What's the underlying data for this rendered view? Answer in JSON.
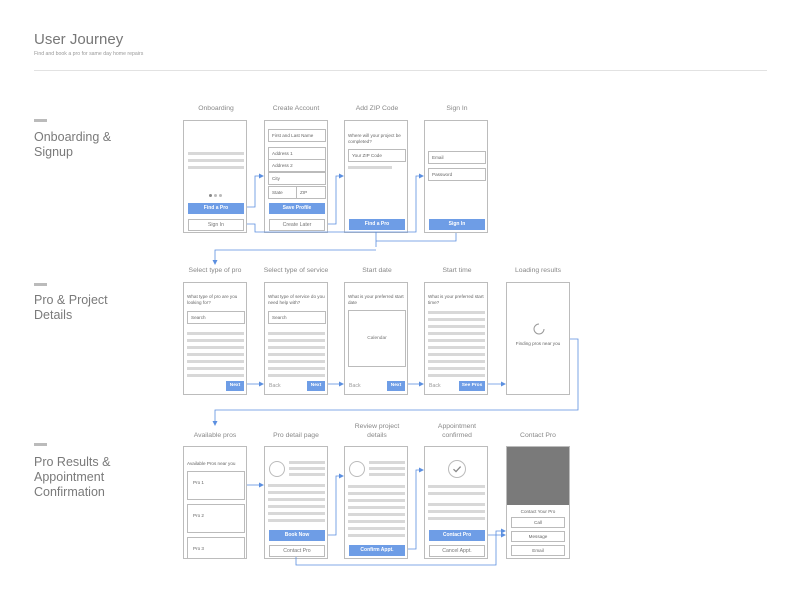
{
  "header": {
    "title": "User Journey",
    "subtitle": "Find and book a pro for same day home repairs"
  },
  "sections": {
    "onboarding": {
      "title": "Onboarding &\nSignup"
    },
    "details": {
      "title": "Pro & Project\nDetails"
    },
    "results": {
      "title": "Pro Results &\nAppointment\nConfirmation"
    }
  },
  "screens": {
    "onboarding": {
      "title": "Onboarding",
      "primary": "Find a Pro",
      "secondary": "Sign In"
    },
    "create_account": {
      "title": "Create Account",
      "fields": [
        "First and Last Name",
        "Address 1",
        "Address 2",
        "City"
      ],
      "state": "State",
      "zip": "ZIP",
      "primary": "Save Profile",
      "secondary": "Create Later"
    },
    "add_zip": {
      "title": "Add ZIP Code",
      "prompt": "Where will your project be completed?",
      "field": "Your ZIP Code",
      "primary": "Find a Pro"
    },
    "sign_in": {
      "title": "Sign In",
      "email": "Email",
      "password": "Password",
      "primary": "Sign In"
    },
    "select_pro": {
      "title": "Select type of pro",
      "prompt": "What type of pro are you looking for?",
      "search": "Search",
      "next": "Next"
    },
    "select_service": {
      "title": "Select type of service",
      "prompt": "What type of service do you need help with?",
      "search": "Search",
      "back": "Back",
      "next": "Next"
    },
    "start_date": {
      "title": "Start date",
      "prompt": "What is your preferred start date",
      "calendar": "Calendar",
      "back": "Back",
      "next": "Next"
    },
    "start_time": {
      "title": "Start time",
      "prompt": "What is your preferred start time?",
      "back": "Back",
      "next": "See Pros"
    },
    "loading": {
      "title": "Loading results",
      "message": "Finding pros near you"
    },
    "available_pros": {
      "title": "Available pros",
      "heading": "Available Pros near you",
      "pros": [
        "Pro 1",
        "Pro 2",
        "Pro 3"
      ]
    },
    "pro_detail": {
      "title": "Pro detail page",
      "primary": "Book Now",
      "secondary": "Contact Pro"
    },
    "review": {
      "title": "Review project\ndetails",
      "primary": "Confirm Appt."
    },
    "confirmed": {
      "title": "Appointment\nconfirmed",
      "primary": "Contact Pro",
      "secondary": "Cancel Appt."
    },
    "contact": {
      "title": "Contact Pro",
      "heading": "Contact Your Pro",
      "options": [
        "Call",
        "Message",
        "Email"
      ]
    }
  },
  "colors": {
    "accent": "#6e9de6",
    "border": "#bcbcbc",
    "placeholder": "#d8d8d8",
    "image_block": "#7a7a7a"
  }
}
